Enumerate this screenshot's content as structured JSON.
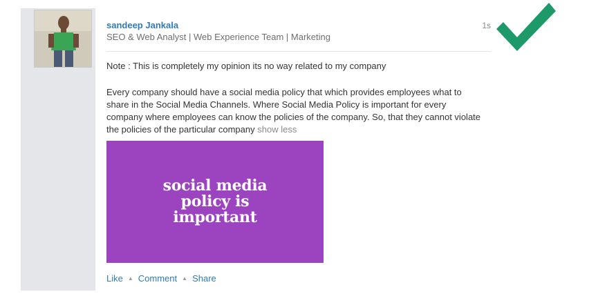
{
  "post": {
    "author_name": "sandeep Jankala",
    "headline": "SEO & Web Analyst | Web Experience Team | Marketing",
    "timestamp": "1s",
    "note": "Note : This is completely my opinion its no way related to my company",
    "body": "Every company should have a social media policy that which provides employees what to share in the Social Media Channels. Where Social Media Policy is important for every company where employees can know the policies of the company. So, that they cannot violate the policies of the particular company",
    "show_less": "show less",
    "image_text": "social media\npolicy is\nimportant",
    "image_color": "#9c44c0"
  },
  "actions": {
    "like": "Like",
    "comment": "Comment",
    "share": "Share",
    "separator": "▲"
  },
  "icons": {
    "checkmark": "checkmark-icon",
    "checkmark_color": "#1e9a6a"
  },
  "colors": {
    "link": "#2d7bbc",
    "rail": "#e5e6e9"
  }
}
